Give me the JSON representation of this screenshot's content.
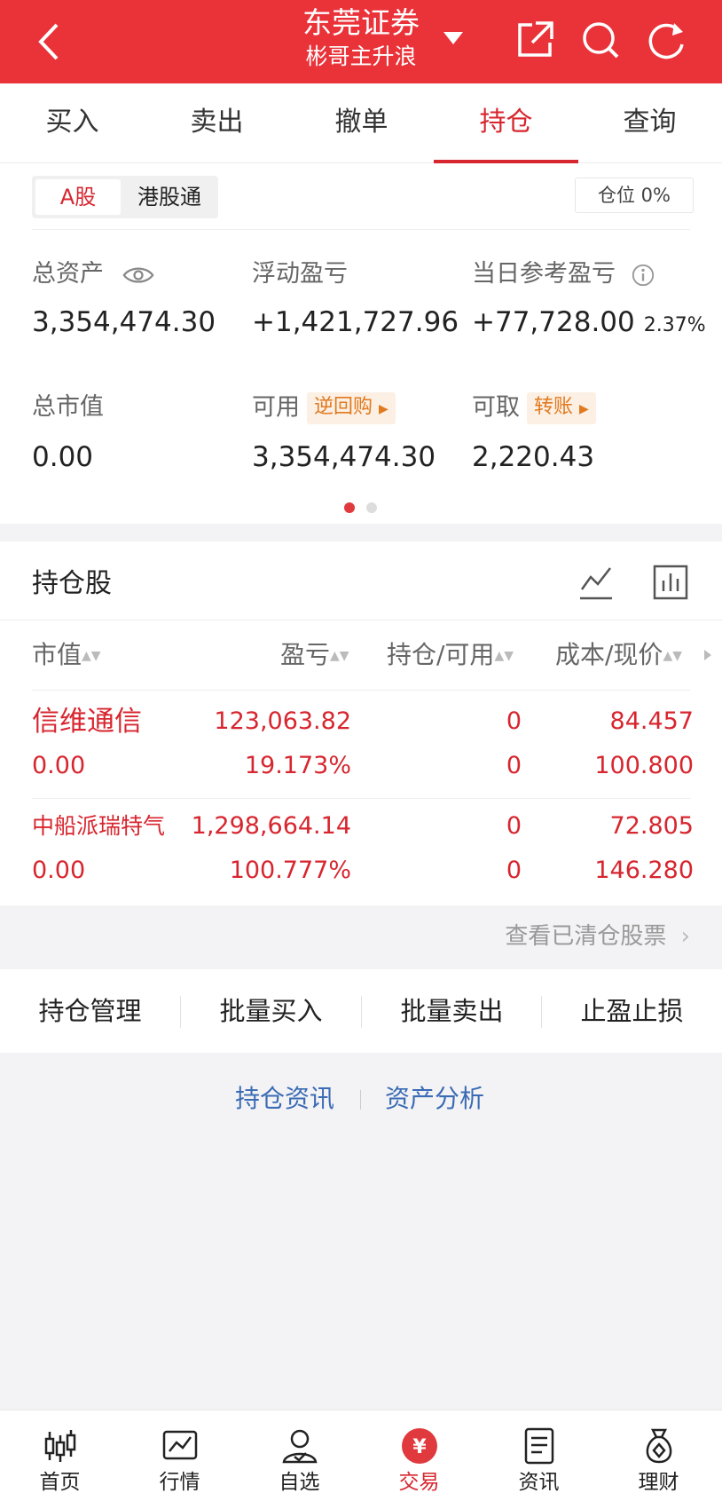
{
  "header": {
    "title": "东莞证券",
    "subtitle": "彬哥主升浪"
  },
  "tabs": [
    {
      "label": "买入"
    },
    {
      "label": "卖出"
    },
    {
      "label": "撤单"
    },
    {
      "label": "持仓",
      "active": true
    },
    {
      "label": "查询"
    }
  ],
  "market": {
    "options": [
      "A股",
      "港股通"
    ],
    "selected": "A股",
    "position_ratio": "仓位 0%"
  },
  "assets": {
    "total_assets_label": "总资产",
    "total_assets": "3,354,474.30",
    "floating_pl_label": "浮动盈亏",
    "floating_pl": "+1,421,727.96",
    "daily_pl_label": "当日参考盈亏",
    "daily_pl": "+77,728.00",
    "daily_pl_pct": "2.37%",
    "market_value_label": "总市值",
    "market_value": "0.00",
    "available_label": "可用",
    "available_pill": "逆回购",
    "available": "3,354,474.30",
    "withdrawable_label": "可取",
    "withdrawable_pill": "转账",
    "withdrawable": "2,220.43"
  },
  "holdings": {
    "title": "持仓股",
    "columns": [
      "市值",
      "盈亏",
      "持仓/可用",
      "成本/现价"
    ],
    "rows": [
      {
        "name": "信维通信",
        "market_value": "0.00",
        "pl": "123,063.82",
        "pl_pct": "19.173%",
        "position": "0",
        "available": "0",
        "cost": "84.457",
        "price": "100.800"
      },
      {
        "name": "中船派瑞特气",
        "market_value": "0.00",
        "pl": "1,298,664.14",
        "pl_pct": "100.777%",
        "position": "0",
        "available": "0",
        "cost": "72.805",
        "price": "146.280"
      }
    ],
    "cleared_link": "查看已清仓股票"
  },
  "actions": [
    "持仓管理",
    "批量买入",
    "批量卖出",
    "止盈止损"
  ],
  "links": [
    "持仓资讯",
    "资产分析"
  ],
  "bottom_nav": [
    {
      "label": "首页",
      "icon": "candlestick-icon"
    },
    {
      "label": "行情",
      "icon": "chart-icon"
    },
    {
      "label": "自选",
      "icon": "user-check-icon"
    },
    {
      "label": "交易",
      "icon": "yen-icon",
      "active": true
    },
    {
      "label": "资讯",
      "icon": "document-icon"
    },
    {
      "label": "理财",
      "icon": "money-bag-icon"
    }
  ],
  "colors": {
    "brand_red": "#ea3239",
    "profit_red": "#d7262f",
    "link_blue": "#3a6bb5"
  }
}
